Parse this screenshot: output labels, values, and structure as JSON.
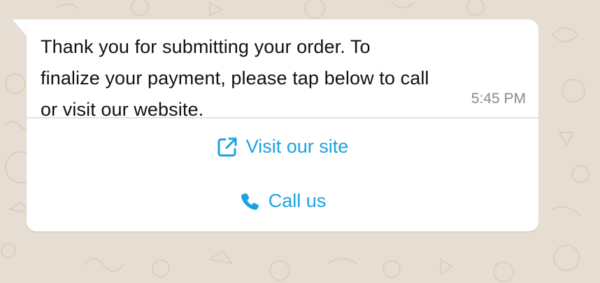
{
  "message": {
    "text": "Thank you for submitting your order. To finalize your payment, please tap below to call or visit our website.",
    "line1": "Thank you for submitting your order. To",
    "line2": "finalize your payment, please tap below to call",
    "line3": "or visit our website.",
    "timestamp": "5:45 PM"
  },
  "actions": [
    {
      "label": "Visit our site",
      "icon": "external-link-icon"
    },
    {
      "label": "Call us",
      "icon": "phone-icon"
    }
  ],
  "colors": {
    "background": "#e7ded3",
    "bubble": "#ffffff",
    "accent": "#1ba3e0",
    "text": "#111111",
    "timestamp": "#8a8a8a"
  }
}
